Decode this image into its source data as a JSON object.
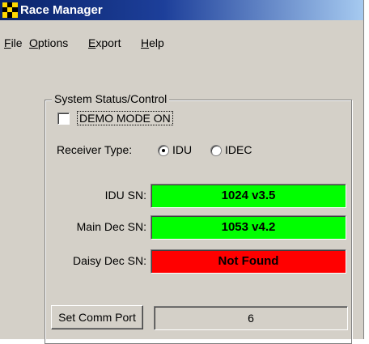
{
  "window": {
    "title": "Race Manager",
    "titlebar_color": "#0a246a"
  },
  "menu": {
    "file": {
      "mnemonic": "F",
      "rest": "ile"
    },
    "options": {
      "mnemonic": "O",
      "rest": "ptions"
    },
    "export": {
      "mnemonic": "E",
      "rest": "xport"
    },
    "help": {
      "mnemonic": "H",
      "rest": "elp"
    }
  },
  "system_status": {
    "group_label": "System Status/Control",
    "demo_mode": {
      "label": "DEMO MODE ON",
      "checked": false
    },
    "receiver_type": {
      "label": "Receiver Type:",
      "options": [
        "IDU",
        "IDEC"
      ],
      "selected": "IDU"
    },
    "idu_sn": {
      "label": "IDU SN:",
      "value": "1024 v3.5",
      "status_color": "#00ff00"
    },
    "main_dec_sn": {
      "label": "Main Dec SN:",
      "value": "1053 v4.2",
      "status_color": "#00ff00"
    },
    "daisy_dec_sn": {
      "label": "Daisy Dec SN:",
      "value": "Not Found",
      "status_color": "#ff0000"
    },
    "comm_port": {
      "button_label": "Set Comm Port",
      "value": "6"
    }
  },
  "icons": {
    "app": "checkered-flag-icon"
  }
}
